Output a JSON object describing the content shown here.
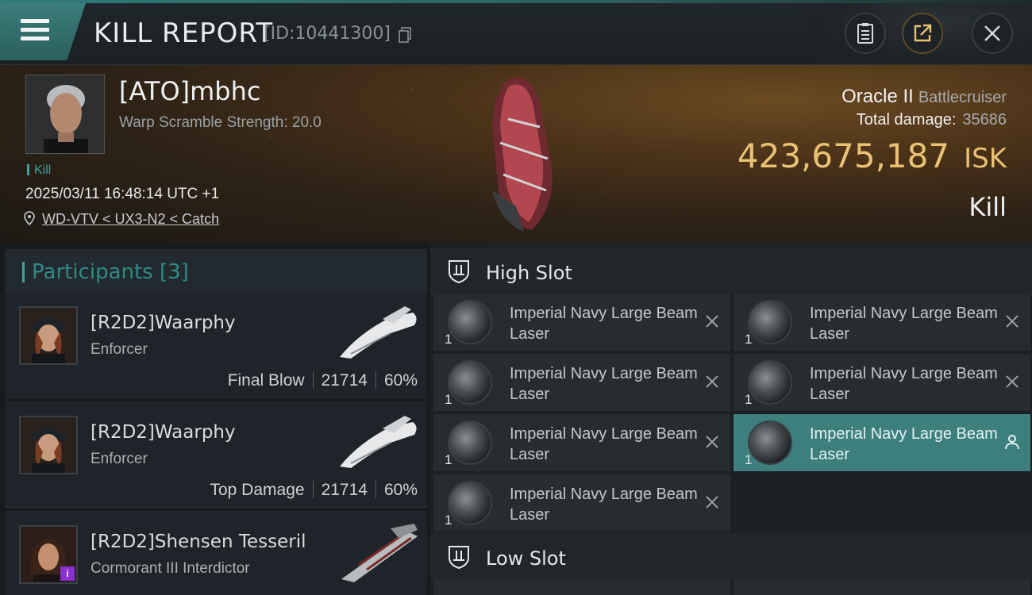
{
  "header": {
    "title": "KILL REPORT",
    "kill_id": "[ID:10441300]",
    "icons": {
      "menu": "hamburger-menu-icon",
      "copy": "copy-icon",
      "notes": "clipboard-icon",
      "share": "share-external-icon",
      "close": "close-icon"
    }
  },
  "victim": {
    "name": "[ATO]mbhc",
    "warp_scramble": "Warp Scramble Strength: 20.0",
    "tag": "Kill",
    "time": "2025/03/11 16:48:14 UTC +1",
    "location": "WD-VTV < UX3-N2 < Catch",
    "ship_name": "Oracle II",
    "ship_class": "Battlecruiser",
    "total_damage_label": "Total damage:",
    "total_damage": "35686",
    "isk_value": "423,675,187",
    "isk_unit": "ISK",
    "result": "Kill",
    "colors": {
      "accent": "#3fa39c",
      "isk": "#e9c273"
    }
  },
  "participants": {
    "header": "Participants [3]",
    "items": [
      {
        "name": "[R2D2]Waarphy",
        "ship": "Enforcer",
        "role": "Final Blow",
        "damage": "21714",
        "percent": "60%"
      },
      {
        "name": "[R2D2]Waarphy",
        "ship": "Enforcer",
        "role": "Top Damage",
        "damage": "21714",
        "percent": "60%"
      },
      {
        "name": "[R2D2]Shensen Tesseril",
        "ship": "Cormorant III Interdictor",
        "badge": "i"
      }
    ]
  },
  "fitting": {
    "high_slot": {
      "title": "High Slot",
      "modules": [
        {
          "name": "Imperial Navy Large Beam Laser",
          "qty": "1",
          "status": "destroyed"
        },
        {
          "name": "Imperial Navy Large Beam Laser",
          "qty": "1",
          "status": "destroyed"
        },
        {
          "name": "Imperial Navy Large Beam Laser",
          "qty": "1",
          "status": "destroyed"
        },
        {
          "name": "Imperial Navy Large Beam Laser",
          "qty": "1",
          "status": "destroyed"
        },
        {
          "name": "Imperial Navy Large Beam Laser",
          "qty": "1",
          "status": "destroyed"
        },
        {
          "name": "Imperial Navy Large Beam Laser",
          "qty": "1",
          "status": "dropped"
        },
        {
          "name": "Imperial Navy Large Beam Laser",
          "qty": "1",
          "status": "destroyed"
        }
      ]
    },
    "low_slot": {
      "title": "Low Slot"
    }
  }
}
